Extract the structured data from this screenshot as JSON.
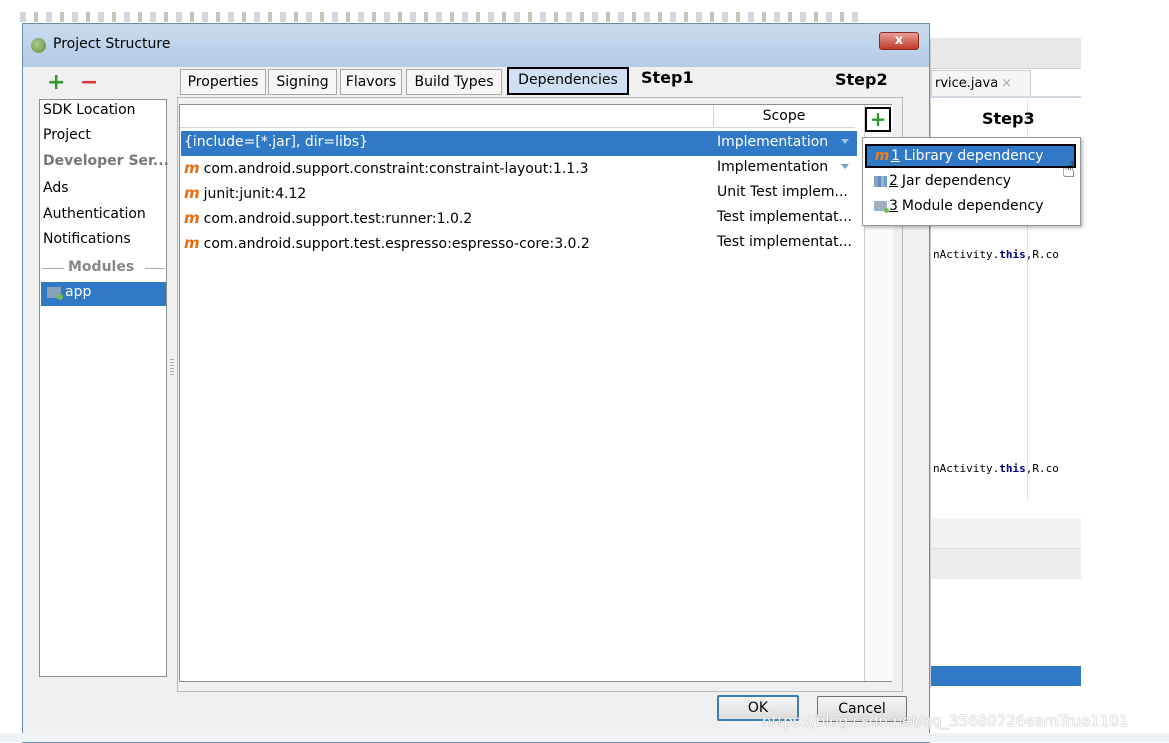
{
  "window": {
    "title": "Project Structure",
    "close_label": "x"
  },
  "sidebar": {
    "add_label": "+",
    "remove_label": "−",
    "items": [
      {
        "label": "SDK Location",
        "bold": false
      },
      {
        "label": "Project",
        "bold": false
      },
      {
        "label": "Developer Ser...",
        "bold": true
      },
      {
        "label": "Ads",
        "bold": false
      },
      {
        "label": "Authentication",
        "bold": false
      },
      {
        "label": "Notifications",
        "bold": false
      }
    ],
    "modules_header": "Modules",
    "module_app": "app"
  },
  "tabs": [
    {
      "label": "Properties"
    },
    {
      "label": "Signing"
    },
    {
      "label": "Flavors"
    },
    {
      "label": "Build Types"
    },
    {
      "label": "Dependencies",
      "active": true
    }
  ],
  "annotations": {
    "step1": "Step1",
    "step2": "Step2",
    "step3": "Step3"
  },
  "table": {
    "scope_header": "Scope",
    "add_dependency_label": "+",
    "rows": [
      {
        "name": "{include=[*.jar], dir=libs}",
        "scope": "Implementation",
        "maven": false,
        "selected": true
      },
      {
        "name": "com.android.support.constraint:constraint-layout:1.1.3",
        "scope": "Implementation",
        "maven": true,
        "selected": false
      },
      {
        "name": "junit:junit:4.12",
        "scope": "Unit Test implem...",
        "maven": true,
        "selected": false
      },
      {
        "name": "com.android.support.test:runner:1.0.2",
        "scope": "Test implementat...",
        "maven": true,
        "selected": false
      },
      {
        "name": "com.android.support.test.espresso:espresso-core:3.0.2",
        "scope": "Test implementat...",
        "maven": true,
        "selected": false
      }
    ],
    "maven_icon_glyph": "m"
  },
  "add_menu": {
    "items": [
      {
        "mnemonic": "1",
        "label": "Library dependency",
        "icon": "maven-library-icon",
        "highlighted": true
      },
      {
        "mnemonic": "2",
        "label": "Jar dependency",
        "icon": "jar-icon",
        "highlighted": false
      },
      {
        "mnemonic": "3",
        "label": "Module dependency",
        "icon": "module-icon",
        "highlighted": false
      }
    ]
  },
  "editor": {
    "tab_label": "rvice.java",
    "tab_close": "×",
    "code_line_1": {
      "pre": "nActivity.",
      "kw": "this",
      "post": ",R.co"
    },
    "code_line_2": {
      "pre": "nActivity.",
      "kw": "this",
      "post": ",R.co"
    }
  },
  "buttons": {
    "ok": "OK",
    "cancel": "Cancel"
  },
  "watermark": "https://blog.csdn.net/qq_35680726eamTrue1101",
  "colors": {
    "selection": "#2f79c7",
    "add_green": "#2e9a2e",
    "remove_red": "#dd3333",
    "maven_orange": "#e86c12"
  }
}
